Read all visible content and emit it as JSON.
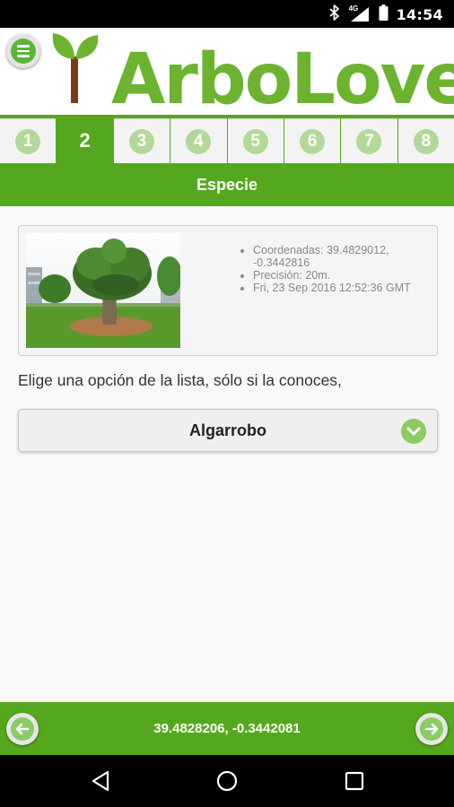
{
  "status_bar": {
    "time": "14:54",
    "network": "4G",
    "icons": [
      "bluetooth-icon",
      "signal-icon",
      "battery-icon"
    ]
  },
  "header": {
    "title": "ArboLove",
    "menu_icon": "menu-icon"
  },
  "steps": [
    {
      "label": "1",
      "active": false
    },
    {
      "label": "2",
      "active": true
    },
    {
      "label": "3",
      "active": false
    },
    {
      "label": "4",
      "active": false
    },
    {
      "label": "5",
      "active": false
    },
    {
      "label": "6",
      "active": false
    },
    {
      "label": "7",
      "active": false
    },
    {
      "label": "8",
      "active": false
    }
  ],
  "section": {
    "title": "Especie"
  },
  "info": {
    "coords_line1": "Coordenadas: 39.4829012,",
    "coords_line2": "-0.3442816",
    "precision": "Precisión: 20m.",
    "date": "Fri, 23 Sep 2016 12:52:36 GMT"
  },
  "prompt": "Elige una opción de la lista, sólo si la conoces,",
  "species_select": {
    "value": "Algarrobo"
  },
  "footer": {
    "coordinates": "39.4828206, -0.3442081"
  },
  "colors": {
    "brand_green": "#55a81d",
    "logo_green": "#6cb42f",
    "light_green": "#8bcb63"
  }
}
